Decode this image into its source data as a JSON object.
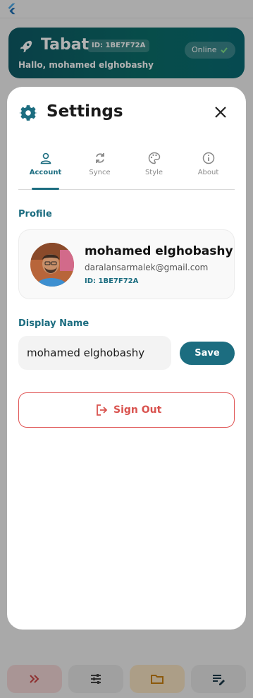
{
  "background": {
    "app_title": "Tabat",
    "user_id_chip": "ID: 1BE7F72A",
    "greeting": "Hallo, mohamed elghobashy",
    "status": "Online",
    "nav_icons": [
      "chevrons-right-icon",
      "sliders-icon",
      "folder-icon",
      "edit-list-icon"
    ],
    "colors": {
      "header": "#0e5b66",
      "nav_red": "#f3d6d6",
      "nav_orange": "#f7e2c2",
      "nav_gray": "#e5e5e5"
    }
  },
  "dialog": {
    "title": "Settings",
    "tabs": [
      {
        "label": "Account",
        "icon": "person-icon",
        "active": true
      },
      {
        "label": "Synce",
        "icon": "sync-icon",
        "active": false
      },
      {
        "label": "Style",
        "icon": "palette-icon",
        "active": false
      },
      {
        "label": "About",
        "icon": "info-icon",
        "active": false
      }
    ],
    "profile_section_label": "Profile",
    "profile": {
      "name": "mohamed elghobashy",
      "email": "daralansarmalek@gmail.com",
      "id": "ID: 1BE7F72A"
    },
    "display_name_label": "Display Name",
    "display_name_value": "mohamed elghobashy",
    "save_label": "Save",
    "sign_out_label": "Sign Out",
    "colors": {
      "accent": "#1c6d80",
      "danger": "#d9534f"
    }
  }
}
